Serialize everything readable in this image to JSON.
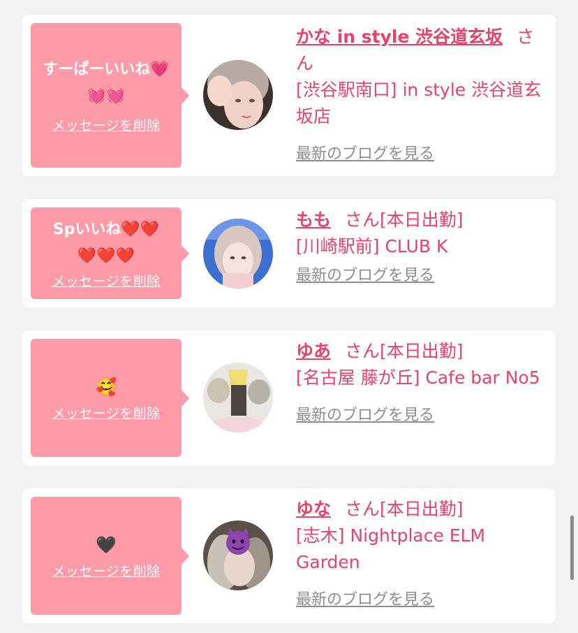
{
  "messages": [
    {
      "bubble_text": "すーぱーいいね💗💓💓",
      "delete_label": "メッセージを削除",
      "name": "かな in style 渋谷道玄坂",
      "honorific": "さん",
      "shop": "[渋谷駅南口] in style 渋谷道玄坂店",
      "blog_label": "最新のブログを見る"
    },
    {
      "bubble_text": "Spいいね❤️❤️❤️❤️❤️",
      "delete_label": "メッセージを削除",
      "name": "もも",
      "honorific": "さん[本日出勤]",
      "shop": "[川崎駅前] CLUB K",
      "blog_label": "最新のブログを見る"
    },
    {
      "bubble_text": "🥰",
      "delete_label": "メッセージを削除",
      "name": "ゆあ",
      "honorific": "さん[本日出勤]",
      "shop": "[名古屋 藤が丘] Cafe bar No5",
      "blog_label": "最新のブログを見る"
    },
    {
      "bubble_text": "🖤",
      "delete_label": "メッセージを削除",
      "name": "ゆな",
      "honorific": "さん[本日出勤]",
      "shop": "[志木] Nightplace ELM Garden",
      "blog_label": "最新のブログを見る"
    }
  ],
  "colors": {
    "page_bg": "#f2f2f2",
    "bubble": "#ff9aa8",
    "accent_text": "#e8436a",
    "link_gray": "#8e8e8e"
  },
  "icons": [
    "avatar-photo",
    "avatar-photo",
    "avatar-photo",
    "avatar-photo-devil-emoji"
  ]
}
